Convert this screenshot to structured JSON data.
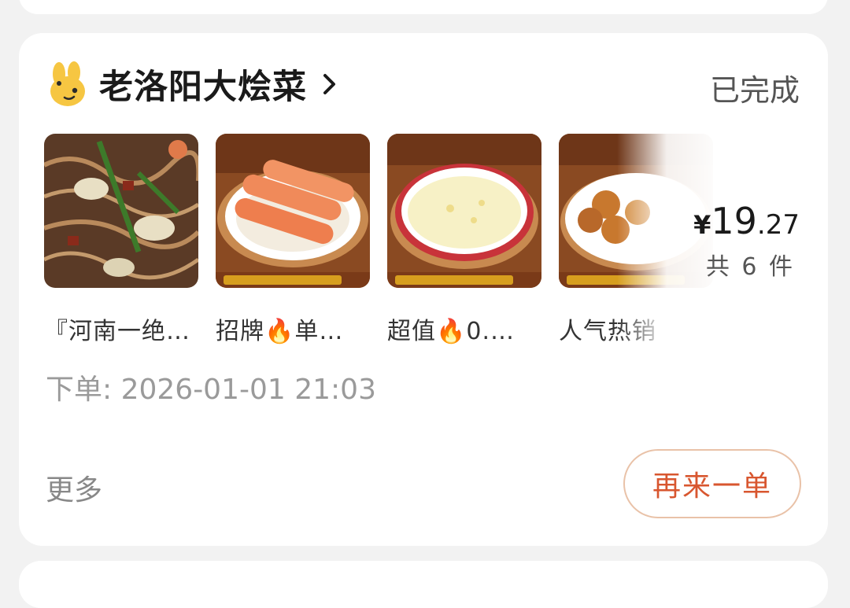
{
  "order": {
    "store": {
      "name": "老洛阳大烩菜",
      "logo_icon": "bunny-logo-icon",
      "chevron_icon": "chevron-right-icon"
    },
    "status": "已完成",
    "items": [
      {
        "name": "『河南一绝…"
      },
      {
        "name": "招牌🔥单…"
      },
      {
        "name": "超值🔥0.…"
      },
      {
        "name": "人气热销"
      }
    ],
    "price": {
      "symbol": "¥",
      "integer": "19",
      "decimal": ".27"
    },
    "count_text": "共 6 件",
    "order_time": "下单: 2026-01-01 21:03",
    "more_label": "更多",
    "reorder_label": "再来一单",
    "accent_color": "#d8562f"
  }
}
